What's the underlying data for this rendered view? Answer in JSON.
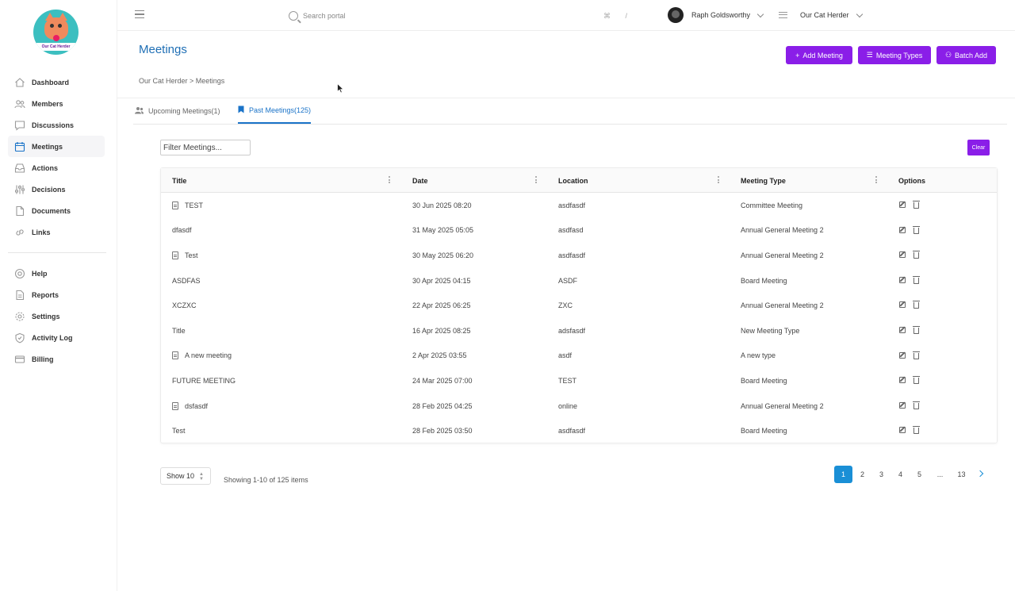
{
  "logo_text": "Our Cat Herder",
  "sidebar": {
    "items": [
      {
        "label": "Dashboard",
        "icon": "home-icon"
      },
      {
        "label": "Members",
        "icon": "members-icon"
      },
      {
        "label": "Discussions",
        "icon": "chat-icon"
      },
      {
        "label": "Meetings",
        "icon": "calendar-icon",
        "active": true
      },
      {
        "label": "Actions",
        "icon": "inbox-icon"
      },
      {
        "label": "Decisions",
        "icon": "sliders-icon"
      },
      {
        "label": "Documents",
        "icon": "document-icon"
      },
      {
        "label": "Links",
        "icon": "link-icon"
      }
    ],
    "secondary": [
      {
        "label": "Help",
        "icon": "help-icon"
      },
      {
        "label": "Reports",
        "icon": "report-icon"
      },
      {
        "label": "Settings",
        "icon": "gear-icon"
      },
      {
        "label": "Activity Log",
        "icon": "shield-icon"
      },
      {
        "label": "Billing",
        "icon": "card-icon"
      }
    ]
  },
  "topbar": {
    "search_placeholder": "Search portal",
    "shortcut": "⌘ /",
    "user_name": "Raph Goldsworthy",
    "org_name": "Our Cat Herder"
  },
  "header": {
    "title": "Meetings",
    "breadcrumb": "Our Cat Herder > Meetings",
    "buttons": {
      "add_meeting": "Add Meeting",
      "meeting_types": "Meeting Types",
      "batch_add": "Batch Add"
    }
  },
  "tabs": {
    "upcoming": "Upcoming Meetings(1)",
    "past": "Past Meetings(125)"
  },
  "filter": {
    "placeholder": "Filter Meetings...",
    "clear_label": "Clear"
  },
  "table": {
    "columns": [
      "Title",
      "Date",
      "Location",
      "Meeting Type",
      "Options"
    ],
    "rows": [
      {
        "title": "TEST",
        "doc": true,
        "date": "30 Jun 2025 08:20",
        "location": "asdfasdf",
        "type": "Committee Meeting"
      },
      {
        "title": "dfasdf",
        "doc": false,
        "date": "31 May 2025 05:05",
        "location": "asdfasd",
        "type": "Annual General Meeting 2"
      },
      {
        "title": "Test",
        "doc": true,
        "date": "30 May 2025 06:20",
        "location": "asdfasdf",
        "type": "Annual General Meeting 2"
      },
      {
        "title": "ASDFAS",
        "doc": false,
        "date": "30 Apr 2025 04:15",
        "location": "ASDF",
        "type": "Board Meeting"
      },
      {
        "title": "XCZXC",
        "doc": false,
        "date": "22 Apr 2025 06:25",
        "location": "ZXC",
        "type": "Annual General Meeting 2"
      },
      {
        "title": "Title",
        "doc": false,
        "date": "16 Apr 2025 08:25",
        "location": "adsfasdf",
        "type": "New Meeting Type"
      },
      {
        "title": "A new meeting",
        "doc": true,
        "date": "2 Apr 2025 03:55",
        "location": "asdf",
        "type": "A new type"
      },
      {
        "title": "FUTURE MEETING",
        "doc": false,
        "date": "24 Mar 2025 07:00",
        "location": "TEST",
        "type": "Board Meeting"
      },
      {
        "title": "dsfasdf",
        "doc": true,
        "date": "28 Feb 2025 04:25",
        "location": "online",
        "type": "Annual General Meeting 2"
      },
      {
        "title": "Test",
        "doc": false,
        "date": "28 Feb 2025 03:50",
        "location": "asdfasdf",
        "type": "Board Meeting"
      }
    ]
  },
  "footer": {
    "show_label": "Show 10",
    "showing_text": "Showing 1-10 of 125 items",
    "pages": [
      "1",
      "2",
      "3",
      "4",
      "5",
      "...",
      "13"
    ],
    "active_page": "1"
  },
  "colors": {
    "accent_purple": "#8a1ee8",
    "accent_blue": "#1a8fd6",
    "title_blue": "#1f6fb5"
  }
}
